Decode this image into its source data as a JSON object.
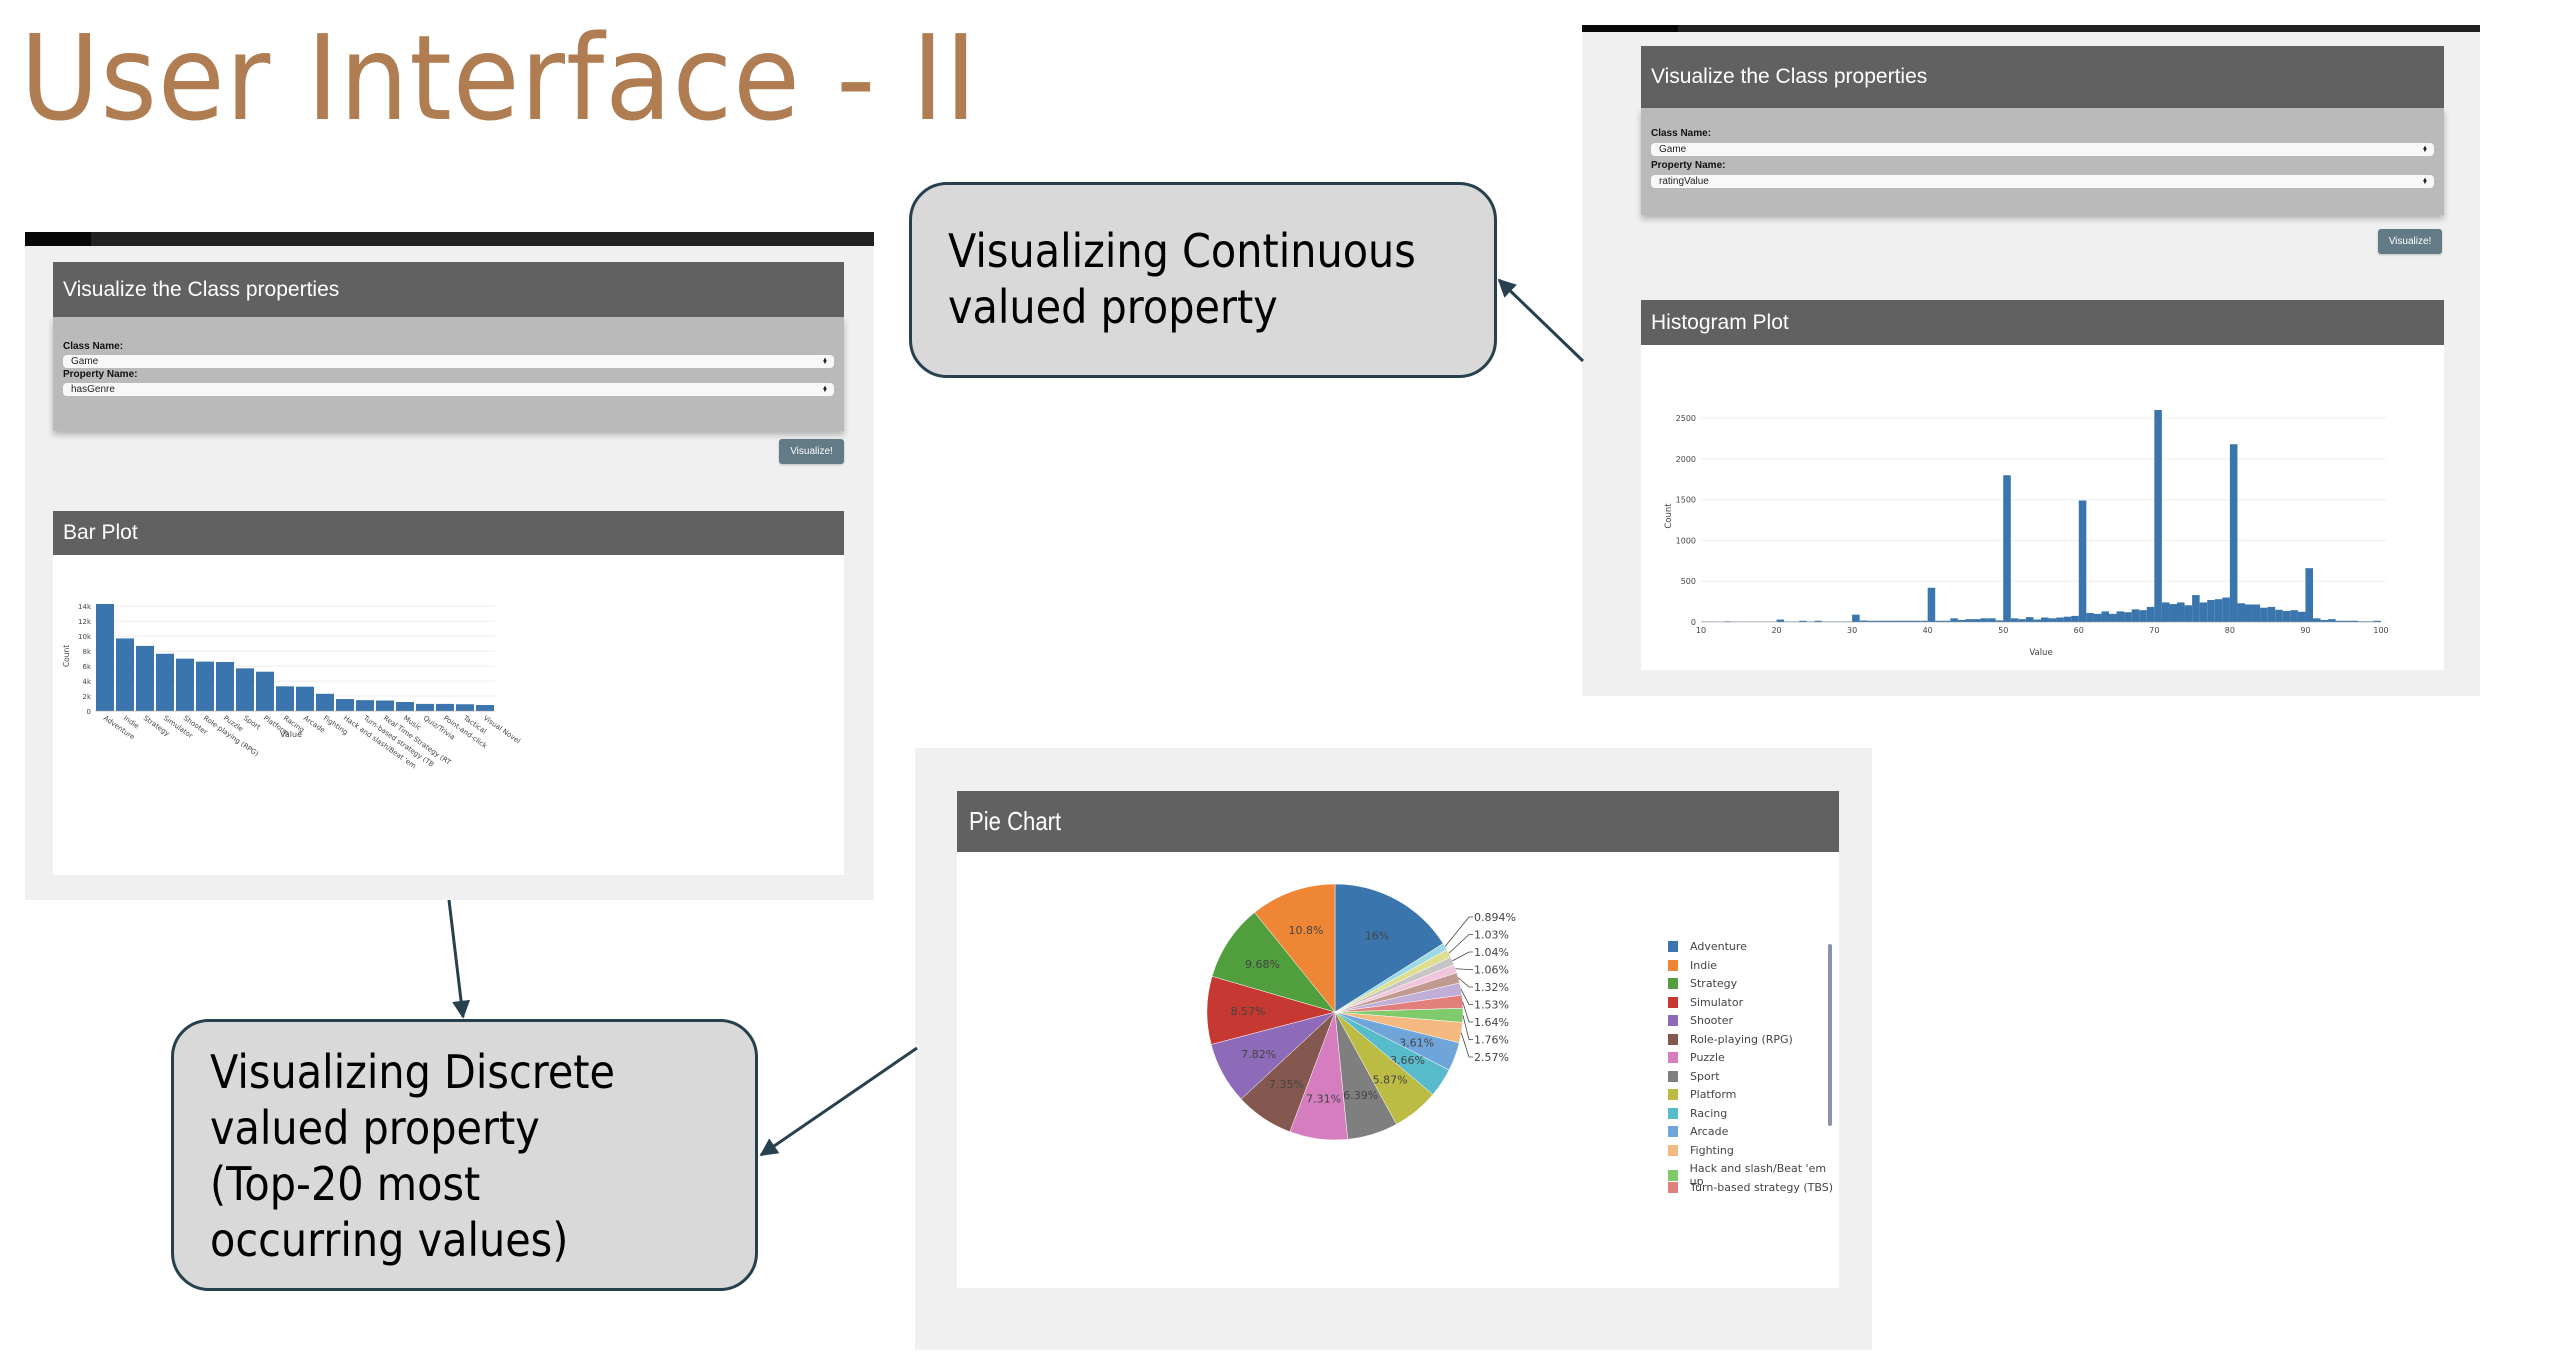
{
  "slide": {
    "title": "User Interface - II",
    "callouts": {
      "continuous": [
        "Visualizing Continuous",
        "valued property"
      ],
      "discrete": [
        "Visualizing Discrete",
        "valued property",
        "(Top-20 most",
        "occurring values)"
      ]
    }
  },
  "colors": {
    "title": "#b07d52",
    "card_header": "#616161",
    "form_bg": "#bababa",
    "button": "#637a87",
    "bar": "#3a76ad",
    "callout_fill": "#d9d9d9",
    "callout_border": "#26404e"
  },
  "discrete_screen": {
    "form_title": "Visualize the Class properties",
    "class_label": "Class Name:",
    "class_value": "Game",
    "property_label": "Property Name:",
    "property_value": "hasGenre",
    "visualize_button": "Visualize!",
    "plot_title": "Bar Plot"
  },
  "continuous_screen": {
    "form_title": "Visualize the Class properties",
    "class_label": "Class Name:",
    "class_value": "Game",
    "property_label": "Property Name:",
    "property_value": "ratingValue",
    "visualize_button": "Visualize!",
    "plot_title": "Histogram Plot"
  },
  "pie_screen": {
    "plot_title": "Pie Chart"
  },
  "chart_data": [
    {
      "type": "bar",
      "title": "Bar Plot",
      "xlabel": "Value",
      "ylabel": "Count",
      "ylim": [
        0,
        14500
      ],
      "yticks": [
        0,
        2000,
        4000,
        6000,
        8000,
        10000,
        12000,
        14000
      ],
      "ytick_labels": [
        "0",
        "2k",
        "4k",
        "6k",
        "8k",
        "10k",
        "12k",
        "14k"
      ],
      "grid": true,
      "categories": [
        "Adventure",
        "Indie",
        "Strategy",
        "Simulator",
        "Shooter",
        "Role-playing (RPG)",
        "Puzzle",
        "Sport",
        "Platform",
        "Racing",
        "Arcade",
        "Fighting",
        "Hack and slash/Beat 'em up",
        "Turn-based strategy (TBS)",
        "Real Time Strategy (RTS)",
        "Music",
        "Quiz/Trivia",
        "Point-and-click",
        "Tactical",
        "Visual Novel"
      ],
      "tick_labels_shown": [
        "Adventure",
        "Indie",
        "Strategy",
        "Simulator",
        "Shooter",
        "Role-playing (RPG)",
        "Puzzle",
        "Sport",
        "Platform",
        "Racing",
        "Arcade",
        "Fighting",
        "Hack and slash/Beat 'em",
        "Turn-based strategy (TB",
        "Real Time Strategy (RT",
        "Music",
        "Quiz/Trivia",
        "Point-and-click",
        "Tactical",
        "Visual Novel"
      ],
      "values": [
        14300,
        9700,
        8700,
        7650,
        7000,
        6600,
        6550,
        5700,
        5250,
        3300,
        3250,
        2300,
        1600,
        1450,
        1400,
        1200,
        950,
        950,
        900,
        800
      ]
    },
    {
      "type": "bar",
      "subtype": "histogram",
      "title": "Histogram Plot",
      "xlabel": "Value",
      "ylabel": "Count",
      "xlim": [
        10,
        100
      ],
      "ylim": [
        0,
        2600
      ],
      "xticks": [
        10,
        20,
        30,
        40,
        50,
        60,
        70,
        80,
        90,
        100
      ],
      "yticks": [
        0,
        500,
        1000,
        1500,
        2000,
        2500
      ],
      "grid": true,
      "bin_width": 1,
      "x": [
        10,
        11,
        12,
        13,
        14,
        15,
        16,
        17,
        18,
        19,
        20,
        21,
        22,
        23,
        24,
        25,
        26,
        27,
        28,
        29,
        30,
        31,
        32,
        33,
        34,
        35,
        36,
        37,
        38,
        39,
        40,
        41,
        42,
        43,
        44,
        45,
        46,
        47,
        48,
        49,
        50,
        51,
        52,
        53,
        54,
        55,
        56,
        57,
        58,
        59,
        60,
        61,
        62,
        63,
        64,
        65,
        66,
        67,
        68,
        69,
        70,
        71,
        72,
        73,
        74,
        75,
        76,
        77,
        78,
        79,
        80,
        81,
        82,
        83,
        84,
        85,
        86,
        87,
        88,
        89,
        90,
        91,
        92,
        93,
        94,
        95,
        96,
        97,
        98,
        99
      ],
      "values": [
        5,
        5,
        3,
        8,
        4,
        4,
        4,
        4,
        4,
        4,
        30,
        6,
        6,
        15,
        6,
        15,
        6,
        6,
        6,
        6,
        90,
        18,
        15,
        15,
        15,
        15,
        15,
        15,
        15,
        15,
        420,
        15,
        15,
        45,
        25,
        35,
        35,
        45,
        45,
        20,
        1800,
        45,
        35,
        60,
        30,
        55,
        45,
        55,
        65,
        75,
        1490,
        110,
        100,
        130,
        100,
        130,
        120,
        155,
        145,
        185,
        2600,
        240,
        220,
        240,
        205,
        330,
        240,
        270,
        280,
        300,
        2180,
        230,
        215,
        215,
        175,
        185,
        150,
        135,
        145,
        125,
        660,
        45,
        25,
        35,
        15,
        15,
        15,
        8,
        8,
        15
      ]
    },
    {
      "type": "pie",
      "title": "Pie Chart",
      "direction": "counterclockwise",
      "labels": [
        "Adventure",
        "Indie",
        "Strategy",
        "Simulator",
        "Shooter",
        "Role-playing (RPG)",
        "Puzzle",
        "Sport",
        "Platform",
        "Racing",
        "Arcade",
        "Fighting",
        "Hack and slash/Beat 'em up",
        "Turn-based strategy (TBS)",
        "Real Time Strategy (RTS)",
        "Music",
        "Quiz/Trivia",
        "Point-and-click",
        "Tactical",
        "Visual Novel"
      ],
      "values": [
        16,
        10.8,
        9.68,
        8.57,
        7.82,
        7.35,
        7.31,
        6.39,
        5.87,
        3.66,
        3.61,
        2.57,
        1.76,
        1.64,
        1.53,
        1.32,
        1.06,
        1.04,
        1.03,
        0.894
      ],
      "value_labels": [
        "16%",
        "10.8%",
        "9.68%",
        "8.57%",
        "7.82%",
        "7.35%",
        "7.31%",
        "6.39%",
        "5.87%",
        "3.66%",
        "3.61%",
        "2.57%",
        "1.76%",
        "1.64%",
        "1.53%",
        "1.32%",
        "1.06%",
        "1.04%",
        "1.03%",
        "0.894%"
      ],
      "colors": [
        "#3a76ad",
        "#ef8636",
        "#519e3e",
        "#c53932",
        "#8d6bb8",
        "#84584e",
        "#d57dbe",
        "#7f7f7f",
        "#bcbc45",
        "#58bbcc",
        "#6fa5d8",
        "#f4b881",
        "#7fcb6c",
        "#e17f7d",
        "#c0aed6",
        "#c09a90",
        "#f0c6db",
        "#c5c5c5",
        "#dede8e",
        "#9dd9e5"
      ],
      "legend_visible": [
        "Adventure",
        "Indie",
        "Strategy",
        "Simulator",
        "Shooter",
        "Role-playing (RPG)",
        "Puzzle",
        "Sport",
        "Platform",
        "Racing",
        "Arcade",
        "Fighting",
        "Hack and slash/Beat 'em up",
        "Turn-based strategy (TBS)"
      ],
      "legend_position": "right"
    }
  ]
}
